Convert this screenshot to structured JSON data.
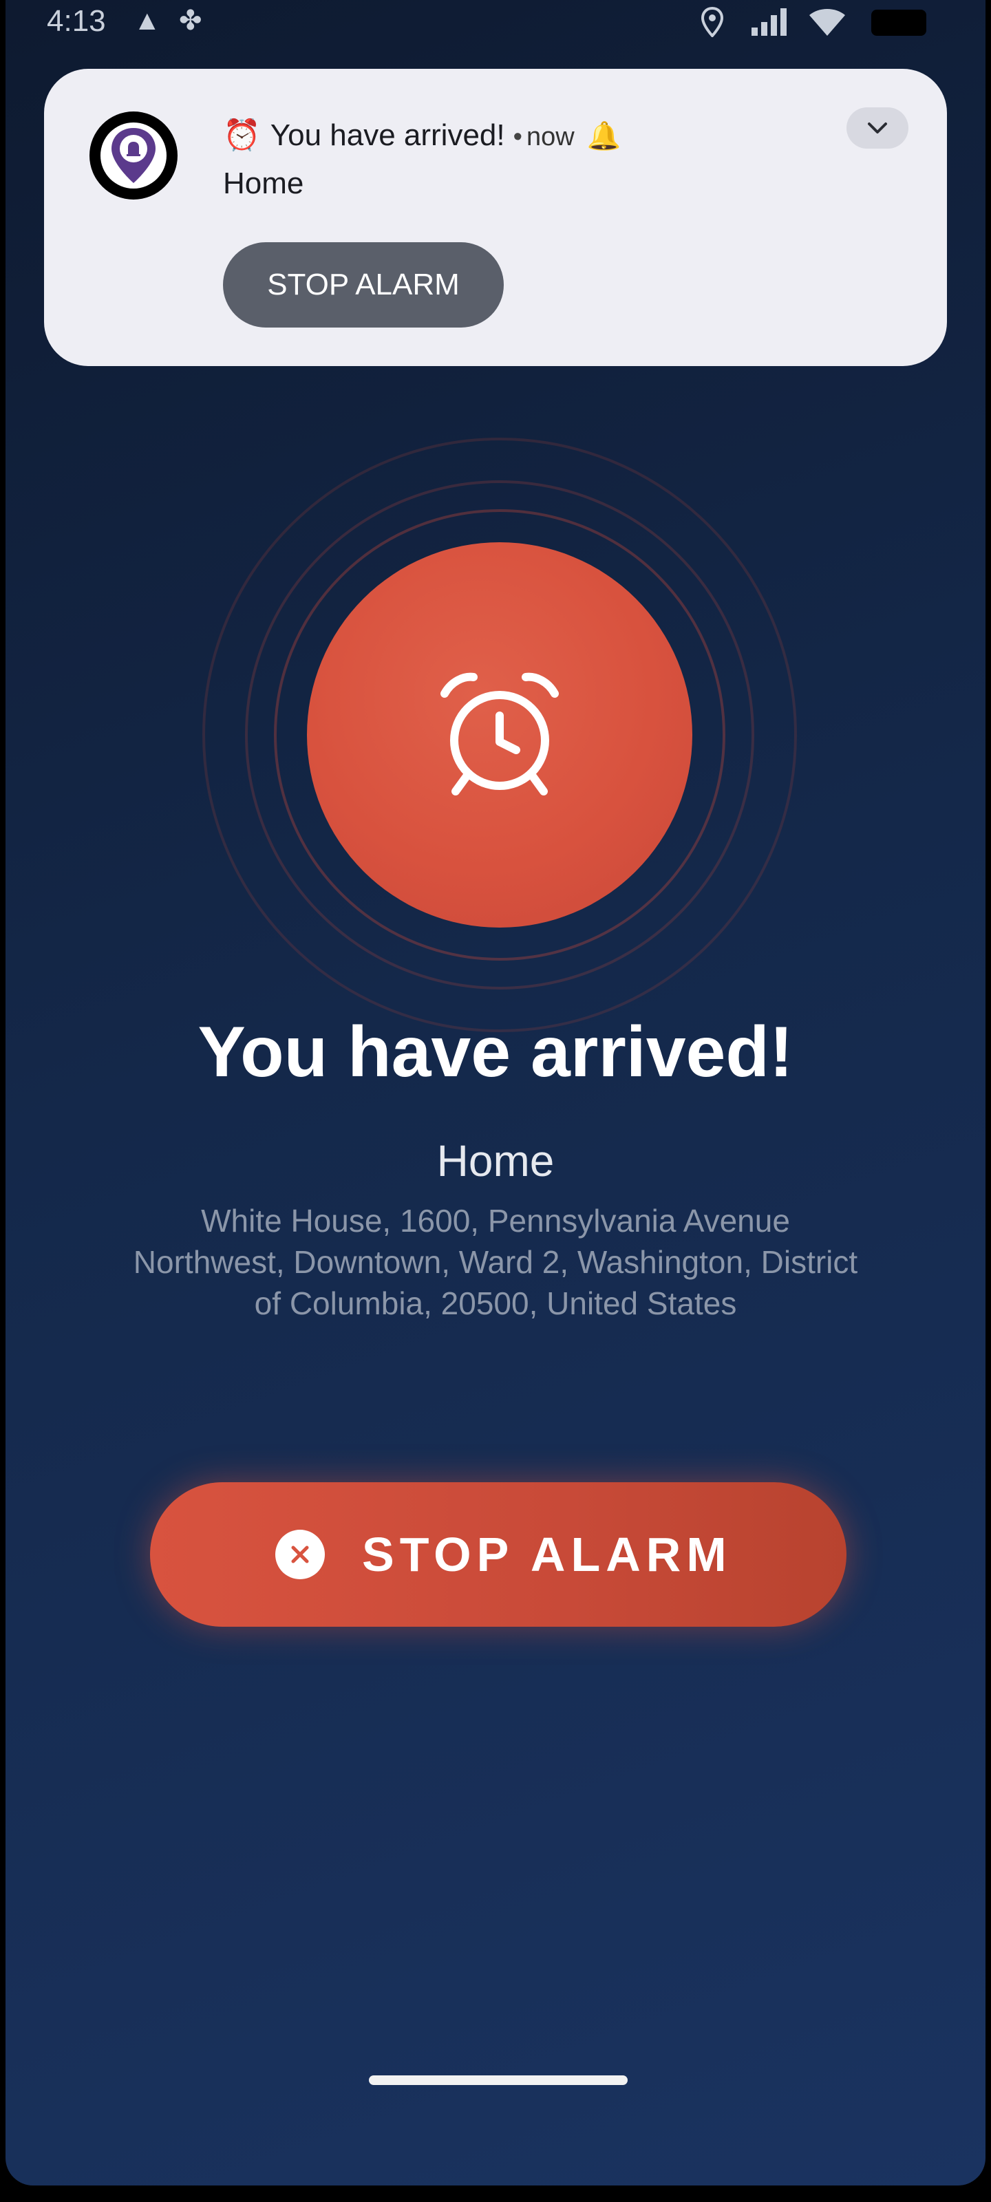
{
  "status_bar": {
    "time": "4:13"
  },
  "notification": {
    "title": "You have arrived!",
    "separator": "•",
    "time": "now",
    "subtitle": "Home",
    "action_label": "STOP ALARM"
  },
  "alarm": {
    "title": "You have arrived!",
    "destination": "Home",
    "address": "White House, 1600, Pennsylvania Avenue Northwest, Downtown, Ward 2, Washington, District of Columbia, 20500, United States",
    "stop_label": "STOP ALARM"
  },
  "colors": {
    "accent": "#d8523e",
    "background": "#14284a",
    "notification_bg": "#eeeef4"
  },
  "icons": [
    "alarm-clock-icon",
    "bell-icon",
    "location-icon",
    "signal-icon",
    "wifi-icon",
    "chevron-down-icon",
    "close-icon"
  ]
}
